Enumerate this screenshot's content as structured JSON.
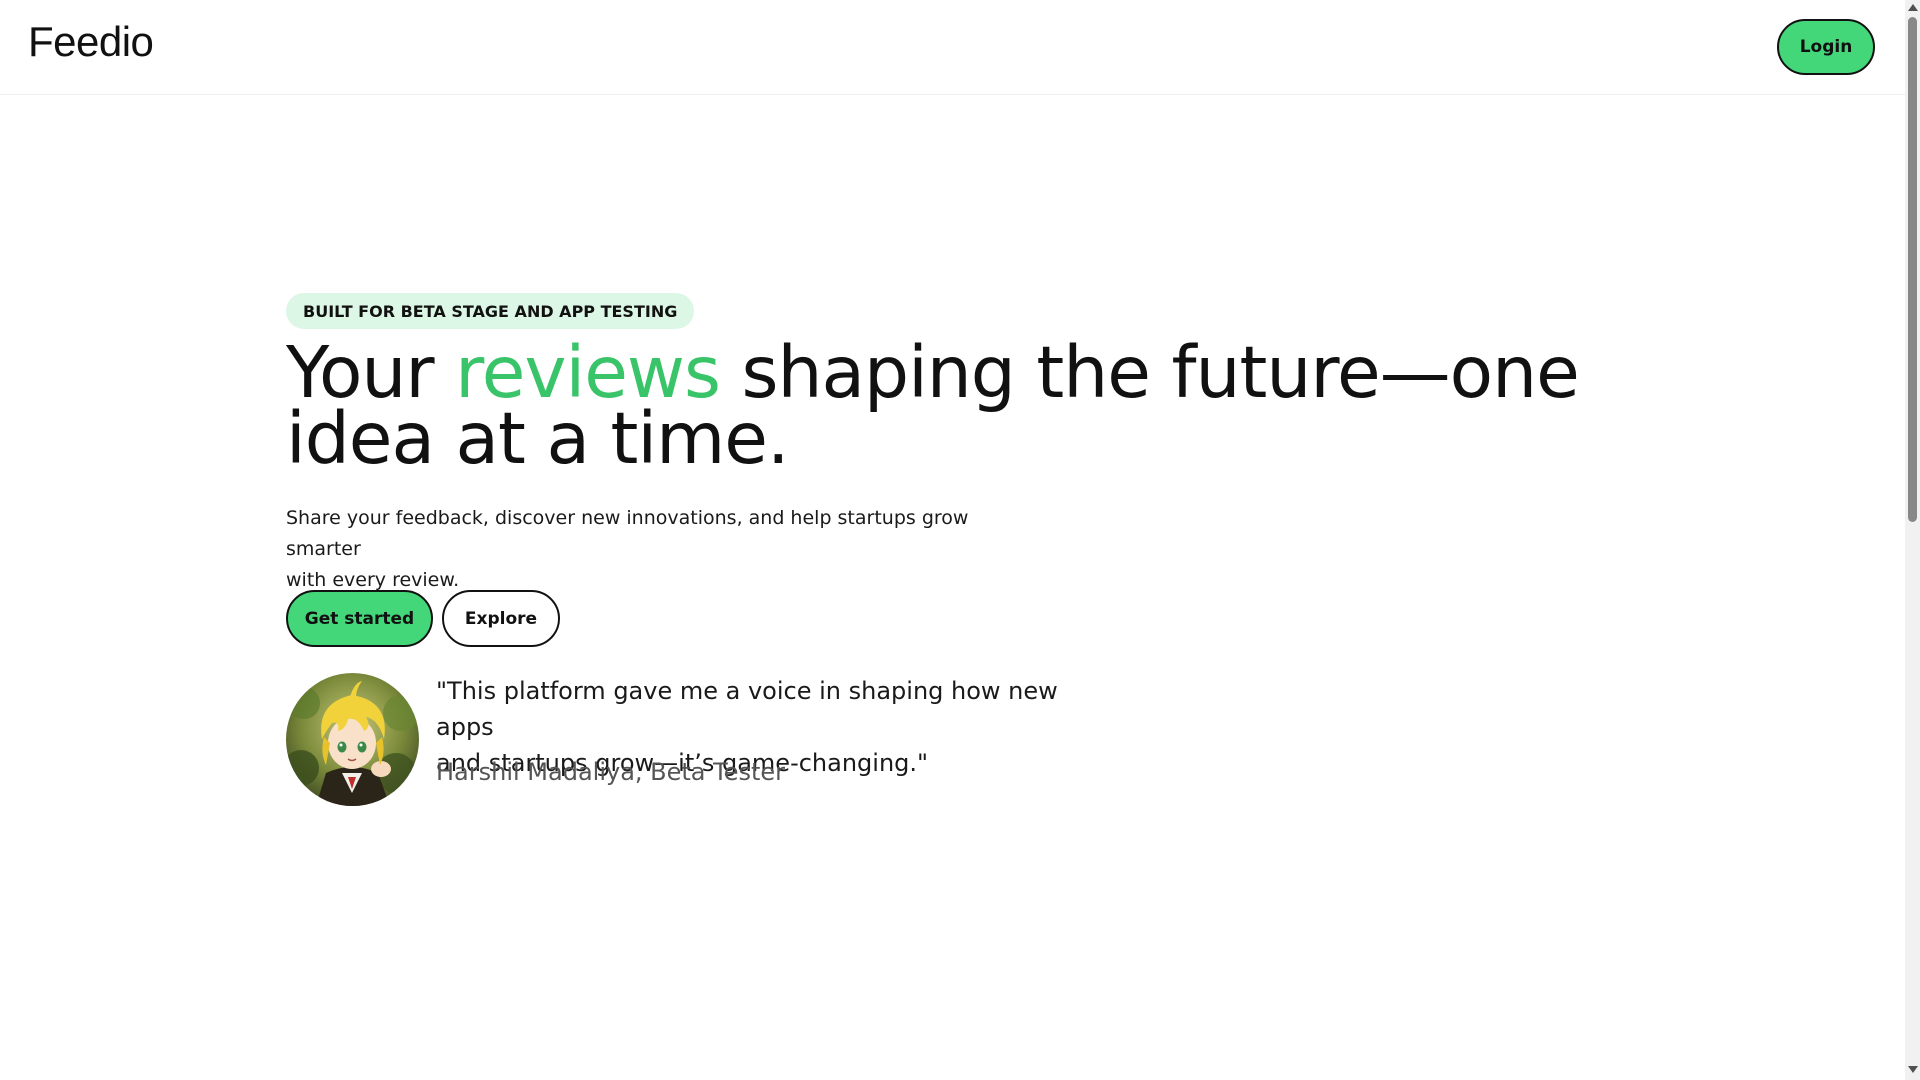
{
  "header": {
    "logo": "Feedio",
    "login_label": "Login"
  },
  "hero": {
    "badge": "BUILT FOR BETA STAGE AND APP TESTING",
    "headline_before": "Your ",
    "headline_accent": "reviews",
    "headline_after": " shaping the future—one idea at a time.",
    "subtext_line1": "Share your feedback, discover new innovations, and help startups grow smarter",
    "subtext_line2": "with every review.",
    "primary_cta": "Get started",
    "secondary_cta": "Explore"
  },
  "testimonial": {
    "avatar_icon": "anime-character-avatar",
    "quote_line1": "\"This platform gave me a voice in shaping how new apps",
    "quote_line2": "and startups grow—it’s game-changing.\"",
    "author": "Harshil Madaliya, Beta Tester"
  },
  "colors": {
    "accent": "#44d77a",
    "accent_text": "#39c46a",
    "badge_bg": "#dcf7e5",
    "text": "#111111",
    "muted": "#555555"
  }
}
